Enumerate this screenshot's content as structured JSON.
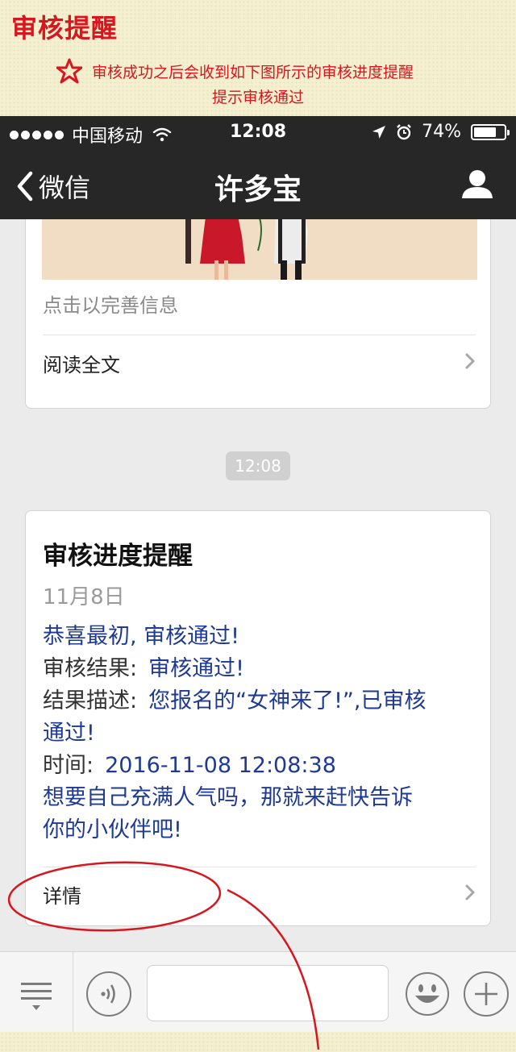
{
  "banner": {
    "title": "审核提醒",
    "line1": "审核成功之后会收到如下图所示的审核进度提醒",
    "line2": "提示审核通过"
  },
  "status_bar": {
    "carrier": "中国移动",
    "time": "12:08",
    "battery": "74%",
    "battery_level": 0.74
  },
  "nav": {
    "back_label": "微信",
    "title": "许多宝"
  },
  "chat": {
    "article_card": {
      "summary": "点击以完善信息",
      "read_more": "阅读全文"
    },
    "timestamp": "12:08",
    "notice_card": {
      "title": "审核进度提醒",
      "date": "11月8日",
      "greeting": "恭喜最初, 审核通过!",
      "result_label": "审核结果:",
      "result_value": "审核通过!",
      "desc_label": "结果描述:",
      "desc_value_1": "您报名的“女神来了!”,已审核",
      "desc_value_2": "通过!",
      "time_label": "时间:",
      "time_value": "2016-11-08 12:08:38",
      "cta_1": "想要自己充满人气吗，那就来赶快告诉",
      "cta_2": "你的小伙伴吧!",
      "details": "详情"
    }
  },
  "colors": {
    "banner_red": "#d7161f",
    "nav_bg": "#272727",
    "chat_bg": "#ebebeb",
    "link_blue": "#1f3a93",
    "annotation_red": "#d7161f"
  },
  "icons": [
    "star-outline-icon",
    "wifi-icon",
    "location-arrow-icon",
    "alarm-icon",
    "battery-icon",
    "back-chevron-icon",
    "user-icon",
    "chevron-right-icon",
    "menu-list-icon",
    "voice-icon",
    "emoji-icon",
    "plus-icon"
  ]
}
